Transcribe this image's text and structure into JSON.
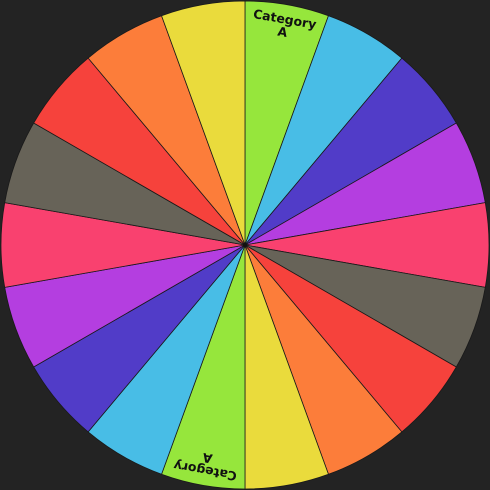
{
  "wheel": {
    "background": "#232323",
    "outline_color": "#1a1a1a",
    "slices": [
      {
        "label_lines": [
          "Category",
          "A"
        ],
        "color": "#96e63c"
      },
      {
        "label_lines": [],
        "color": "#48bde6"
      },
      {
        "label_lines": [],
        "color": "#513cc8"
      },
      {
        "label_lines": [],
        "color": "#b43ee0"
      },
      {
        "label_lines": [],
        "color": "#f9416f"
      },
      {
        "label_lines": [],
        "color": "#676358"
      },
      {
        "label_lines": [],
        "color": "#f6423c"
      },
      {
        "label_lines": [],
        "color": "#fc7d3a"
      },
      {
        "label_lines": [],
        "color": "#eadb3c"
      },
      {
        "label_lines": [
          "Category",
          "A"
        ],
        "color": "#96e63c"
      },
      {
        "label_lines": [],
        "color": "#48bde6"
      },
      {
        "label_lines": [],
        "color": "#513cc8"
      },
      {
        "label_lines": [],
        "color": "#b43ee0"
      },
      {
        "label_lines": [],
        "color": "#f9416f"
      },
      {
        "label_lines": [],
        "color": "#676358"
      },
      {
        "label_lines": [],
        "color": "#f6423c"
      },
      {
        "label_lines": [],
        "color": "#fc7d3a"
      },
      {
        "label_lines": [],
        "color": "#eadb3c"
      }
    ]
  }
}
